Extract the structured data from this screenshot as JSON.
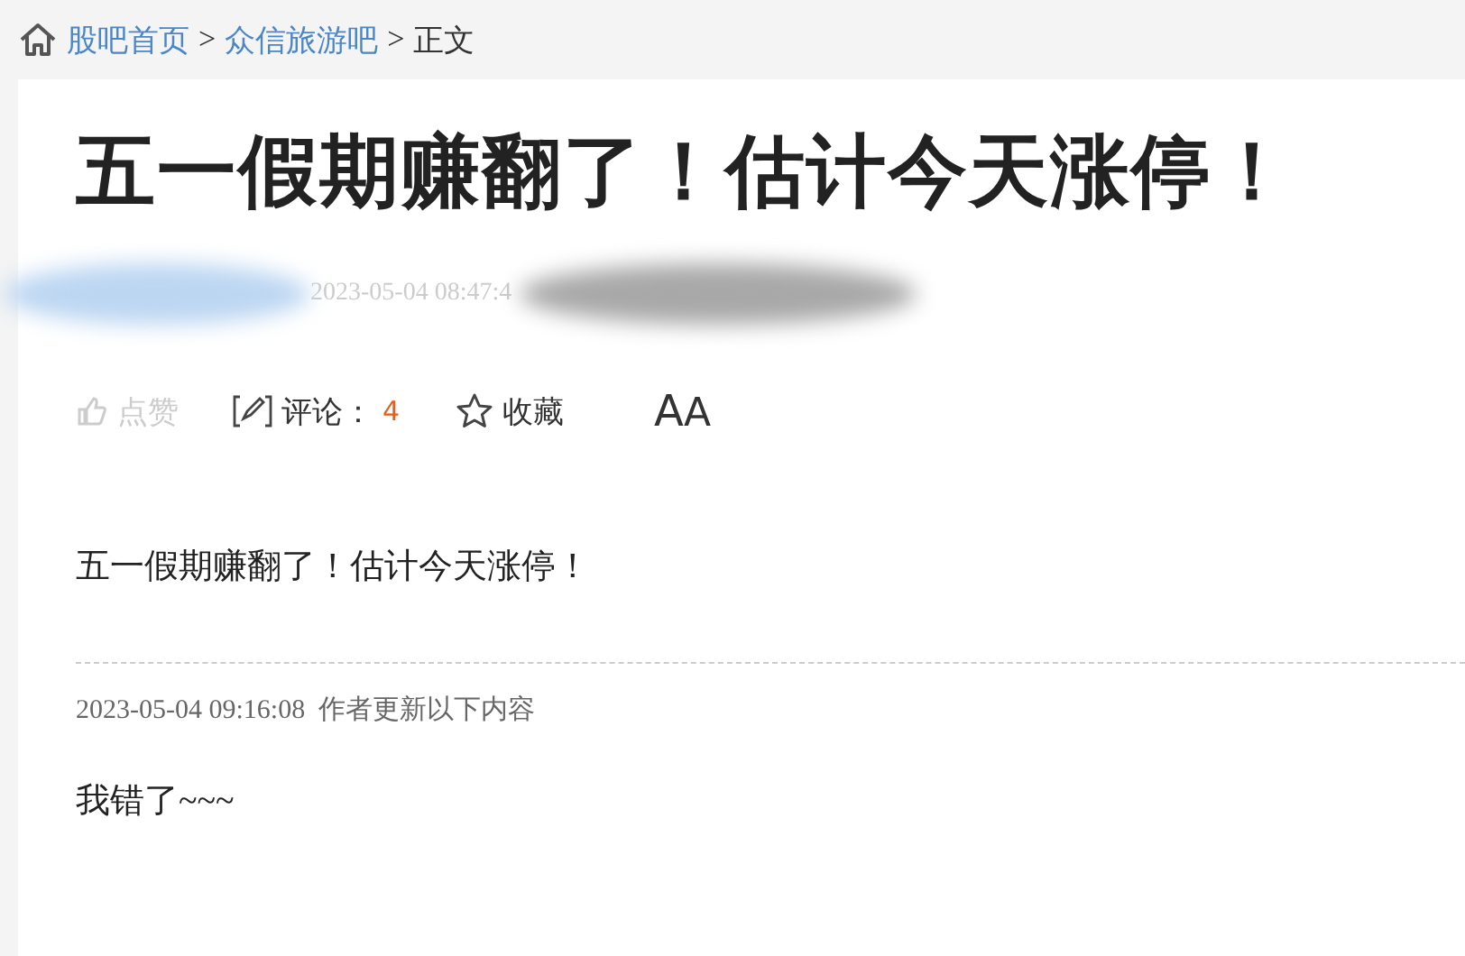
{
  "breadcrumb": [
    {
      "label": "股吧首页",
      "link": true
    },
    {
      "label": "众信旅游吧",
      "link": true
    },
    {
      "label": "正文",
      "link": false
    }
  ],
  "breadcrumb_separator": ">",
  "post": {
    "title": "五一假期赚翻了！估计今天涨停！",
    "time": "2023-05-04 08:47:4",
    "actions": [
      {
        "kind": "like",
        "label": "点赞",
        "disabled": true
      },
      {
        "kind": "comment",
        "label": "评论：",
        "count": "4",
        "disabled": false
      },
      {
        "kind": "favorite",
        "label": "收藏",
        "disabled": false
      },
      {
        "kind": "font",
        "label": "AA",
        "disabled": false
      }
    ],
    "body": "五一假期赚翻了！估计今天涨停！",
    "update": {
      "time": "2023-05-04 09:16:08",
      "note": "作者更新以下内容",
      "text": "我错了~~~"
    }
  }
}
